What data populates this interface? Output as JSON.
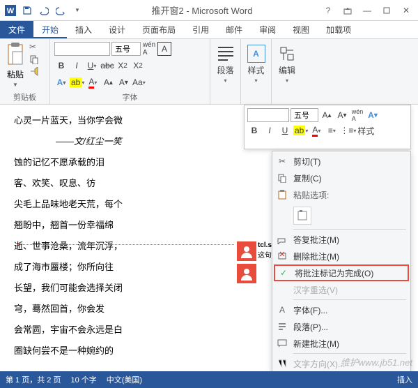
{
  "title": "推开窗2 - Microsoft Word",
  "tabs": {
    "file": "文件",
    "home": "开始",
    "insert": "插入",
    "design": "设计",
    "layout": "页面布局",
    "references": "引用",
    "mailings": "邮件",
    "review": "审阅",
    "view": "视图",
    "addins": "加载项"
  },
  "ribbon": {
    "clipboard": {
      "paste": "粘贴",
      "label": "剪贴板"
    },
    "font": {
      "name": "",
      "size": "五号",
      "label": "字体"
    },
    "paragraph": "段落",
    "styles": "样式",
    "editing": "编辑"
  },
  "mini": {
    "size": "五号",
    "styles": "样式"
  },
  "context": {
    "cut": "剪切(T)",
    "copy": "复制(C)",
    "paste_header": "粘贴选项:",
    "reply": "答复批注(M)",
    "delete": "删除批注(M)",
    "mark_done": "将批注标记为完成(O)",
    "reconvert": "汉字重选(V)",
    "font": "字体(F)...",
    "paragraph": "段落(P)...",
    "new_comment": "新建批注(M)",
    "text_direction": "文字方向(X)..."
  },
  "comment": {
    "author": "tcl.se",
    "text": "这句话"
  },
  "doc": {
    "l1": "心灵一片蓝天，当你学会微",
    "l2": "——文/红尘一笑",
    "l3": "蚀的记忆不愿承载的泪",
    "l4": "客、欢笑、叹息、彷",
    "l5": "尖毛上品味地老天荒，每个",
    "l6": "翘盼中，翘首一份幸福绵",
    "l7": "逝、世事沧桑，流年沉浮，",
    "l8": "成了海市蜃楼；你所向往",
    "l9": "长望，我们可能会选择关闭",
    "l10": "穹，蓦然回首，你会发",
    "l11": "会常圆，宇宙不会永远是白",
    "l12": "圈缺何尝不是一种婉约的"
  },
  "status": {
    "page": "第 1 页，共 2 页",
    "words": "10 个字",
    "lang": "中文(美国)",
    "insert": "插入"
  },
  "watermark": "维护www.jb51.net"
}
